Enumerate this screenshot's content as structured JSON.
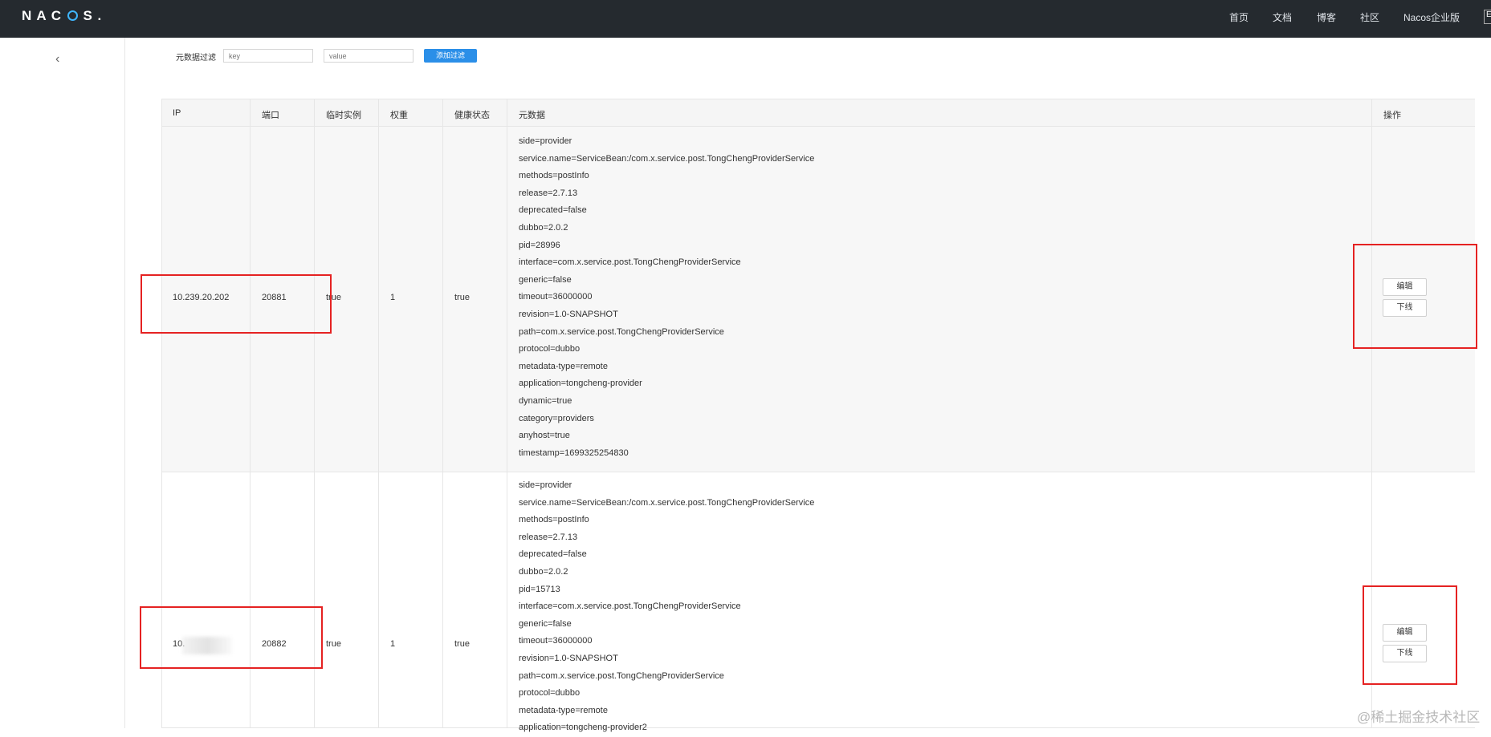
{
  "header": {
    "logo_text": "NACOS.",
    "nav": [
      "首页",
      "文档",
      "博客",
      "社区",
      "Nacos企业版"
    ],
    "lang": "E"
  },
  "sidebar": {
    "collapse_icon": "chevron-left-icon"
  },
  "filter": {
    "label": "元数据过滤",
    "key_placeholder": "key",
    "value_placeholder": "value",
    "add_button": "添加过滤"
  },
  "table": {
    "headers": [
      "IP",
      "端口",
      "临时实例",
      "权重",
      "健康状态",
      "元数据",
      "操作"
    ],
    "rows": [
      {
        "ip": "10.239.20.202",
        "port": "20881",
        "ephemeral": "true",
        "weight": "1",
        "healthy": "true",
        "metadata": [
          "side=provider",
          "service.name=ServiceBean:/com.x.service.post.TongChengProviderService",
          "methods=postInfo",
          "release=2.7.13",
          "deprecated=false",
          "dubbo=2.0.2",
          "pid=28996",
          "interface=com.x.service.post.TongChengProviderService",
          "generic=false",
          "timeout=36000000",
          "revision=1.0-SNAPSHOT",
          "path=com.x.service.post.TongChengProviderService",
          "protocol=dubbo",
          "metadata-type=remote",
          "application=tongcheng-provider",
          "dynamic=true",
          "category=providers",
          "anyhost=true",
          "timestamp=1699325254830"
        ],
        "actions": [
          "编辑",
          "下线"
        ]
      },
      {
        "ip": "10.",
        "port": "20882",
        "ephemeral": "true",
        "weight": "1",
        "healthy": "true",
        "metadata": [
          "side=provider",
          "service.name=ServiceBean:/com.x.service.post.TongChengProviderService",
          "methods=postInfo",
          "release=2.7.13",
          "deprecated=false",
          "dubbo=2.0.2",
          "pid=15713",
          "interface=com.x.service.post.TongChengProviderService",
          "generic=false",
          "timeout=36000000",
          "revision=1.0-SNAPSHOT",
          "path=com.x.service.post.TongChengProviderService",
          "protocol=dubbo",
          "metadata-type=remote",
          "application=tongcheng-provider2"
        ],
        "actions": [
          "编辑",
          "下线"
        ]
      }
    ]
  },
  "watermark": "@稀土掘金技术社区",
  "colors": {
    "header_bg": "#252a2f",
    "accent": "#2b8fe8",
    "highlight_box": "#e52222"
  }
}
